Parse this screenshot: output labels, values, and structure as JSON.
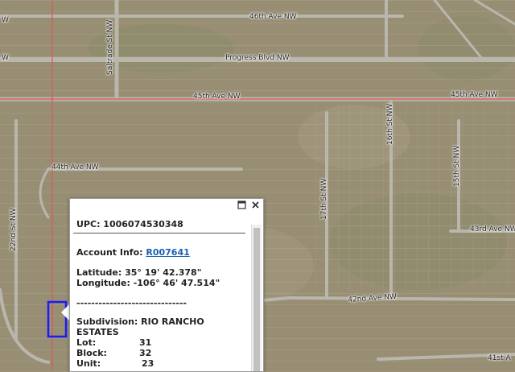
{
  "map": {
    "roads": {
      "ave_46th": "46th Ave NW",
      "progress_blvd": "Progress Blvd NW",
      "ave_45th_left": "45th Ave NW",
      "ave_45th_right": "45th Ave NW",
      "ave_44th": "44th Ave NW",
      "ave_43rd": "43rd Ave NW",
      "ave_42nd": "42nd Ave NW",
      "ave_41st": "41st A",
      "saltrade_st": "Saltrade St NW",
      "st_22nd": "22nd St NW",
      "st_17th": "17th St NW",
      "st_16th": "16th St NW",
      "st_15th": "15th St NW",
      "edge_top_left": "W",
      "edge_mid_left": "W"
    },
    "colors": {
      "boundary": "#e05555",
      "parcel_highlight": "#1a1aff",
      "road": "#b9b6ac"
    }
  },
  "popup": {
    "upc_label": "UPC: 1006074530348",
    "account_label": "Account Info: ",
    "account_link": "R007641",
    "latitude": "Latitude: 35° 19' 42.378\"",
    "longitude": "Longitude: -106° 46' 47.514\"",
    "separator": "------------------------------",
    "subdivision_1": "Subdivision: RIO RANCHO",
    "subdivision_2": "ESTATES",
    "lot_label": "Lot:",
    "lot_value": "31",
    "block_label": "Block:",
    "block_value": "32",
    "unit_label": "Unit:",
    "unit_value": "23",
    "separator_bottom": "------------------------------",
    "icons": {
      "maximize": "maximize-icon",
      "close": "close-icon"
    }
  }
}
